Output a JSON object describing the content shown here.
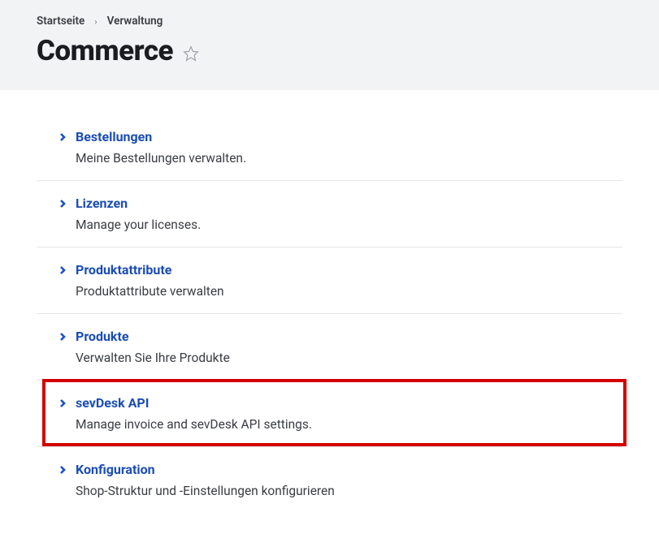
{
  "breadcrumb": {
    "home": "Startseite",
    "verwaltung": "Verwaltung"
  },
  "page_title": "Commerce",
  "items": [
    {
      "title": "Bestellungen",
      "desc": "Meine Bestellungen verwalten."
    },
    {
      "title": "Lizenzen",
      "desc": "Manage your licenses."
    },
    {
      "title": "Produktattribute",
      "desc": "Produktattribute verwalten"
    },
    {
      "title": "Produkte",
      "desc": "Verwalten Sie Ihre Produkte"
    },
    {
      "title": "sevDesk API",
      "desc": "Manage invoice and sevDesk API settings."
    },
    {
      "title": "Konfiguration",
      "desc": "Shop-Struktur und -Einstellungen konfigurieren"
    }
  ]
}
